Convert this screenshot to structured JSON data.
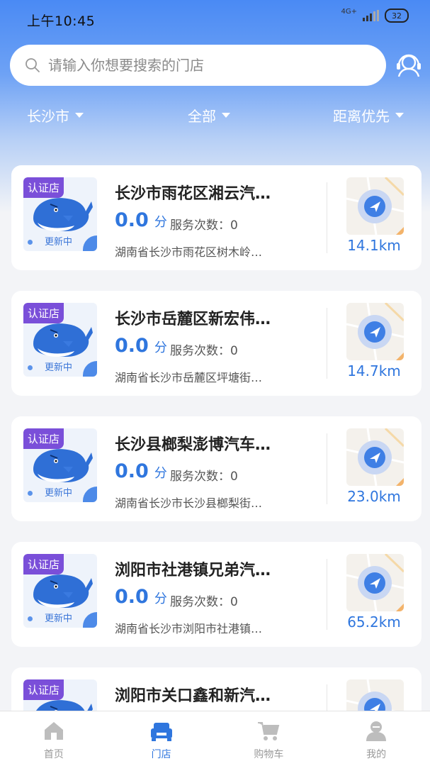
{
  "status_bar": {
    "time": "上午10:45",
    "network": "4G+",
    "battery": "32"
  },
  "search": {
    "placeholder": "请输入你想要搜索的门店",
    "value": ""
  },
  "filters": {
    "city": "长沙市",
    "category": "全部",
    "sort": "距离优先"
  },
  "stores": [
    {
      "badge": "认证店",
      "update_label": "更新中",
      "name": "长沙市雨花区湘云汽…",
      "score": "0.0",
      "score_unit": "分",
      "service_label": "服务次数：",
      "service_count": "0",
      "address": "湖南省长沙市雨花区树木岭…",
      "distance": "14.1km"
    },
    {
      "badge": "认证店",
      "update_label": "更新中",
      "name": "长沙市岳麓区新宏伟…",
      "score": "0.0",
      "score_unit": "分",
      "service_label": "服务次数：",
      "service_count": "0",
      "address": "湖南省长沙市岳麓区坪塘街…",
      "distance": "14.7km"
    },
    {
      "badge": "认证店",
      "update_label": "更新中",
      "name": "长沙县榔梨澎博汽车…",
      "score": "0.0",
      "score_unit": "分",
      "service_label": "服务次数：",
      "service_count": "0",
      "address": "湖南省长沙市长沙县榔梨街…",
      "distance": "23.0km"
    },
    {
      "badge": "认证店",
      "update_label": "更新中",
      "name": "浏阳市社港镇兄弟汽…",
      "score": "0.0",
      "score_unit": "分",
      "service_label": "服务次数：",
      "service_count": "0",
      "address": "湖南省长沙市浏阳市社港镇…",
      "distance": "65.2km"
    },
    {
      "badge": "认证店",
      "update_label": "更新中",
      "name": "浏阳市关口鑫和新汽…",
      "score": "",
      "score_unit": "",
      "service_label": "",
      "service_count": "",
      "address": "",
      "distance": ""
    }
  ],
  "tabs": [
    {
      "label": "首页",
      "icon": "home-icon"
    },
    {
      "label": "门店",
      "icon": "store-icon",
      "active": true
    },
    {
      "label": "购物车",
      "icon": "cart-icon"
    },
    {
      "label": "我的",
      "icon": "profile-icon"
    }
  ],
  "colors": {
    "accent": "#2f76de",
    "header_top": "#4a8af4",
    "badge": "#7a4fd9",
    "background": "#f3f4f7"
  }
}
